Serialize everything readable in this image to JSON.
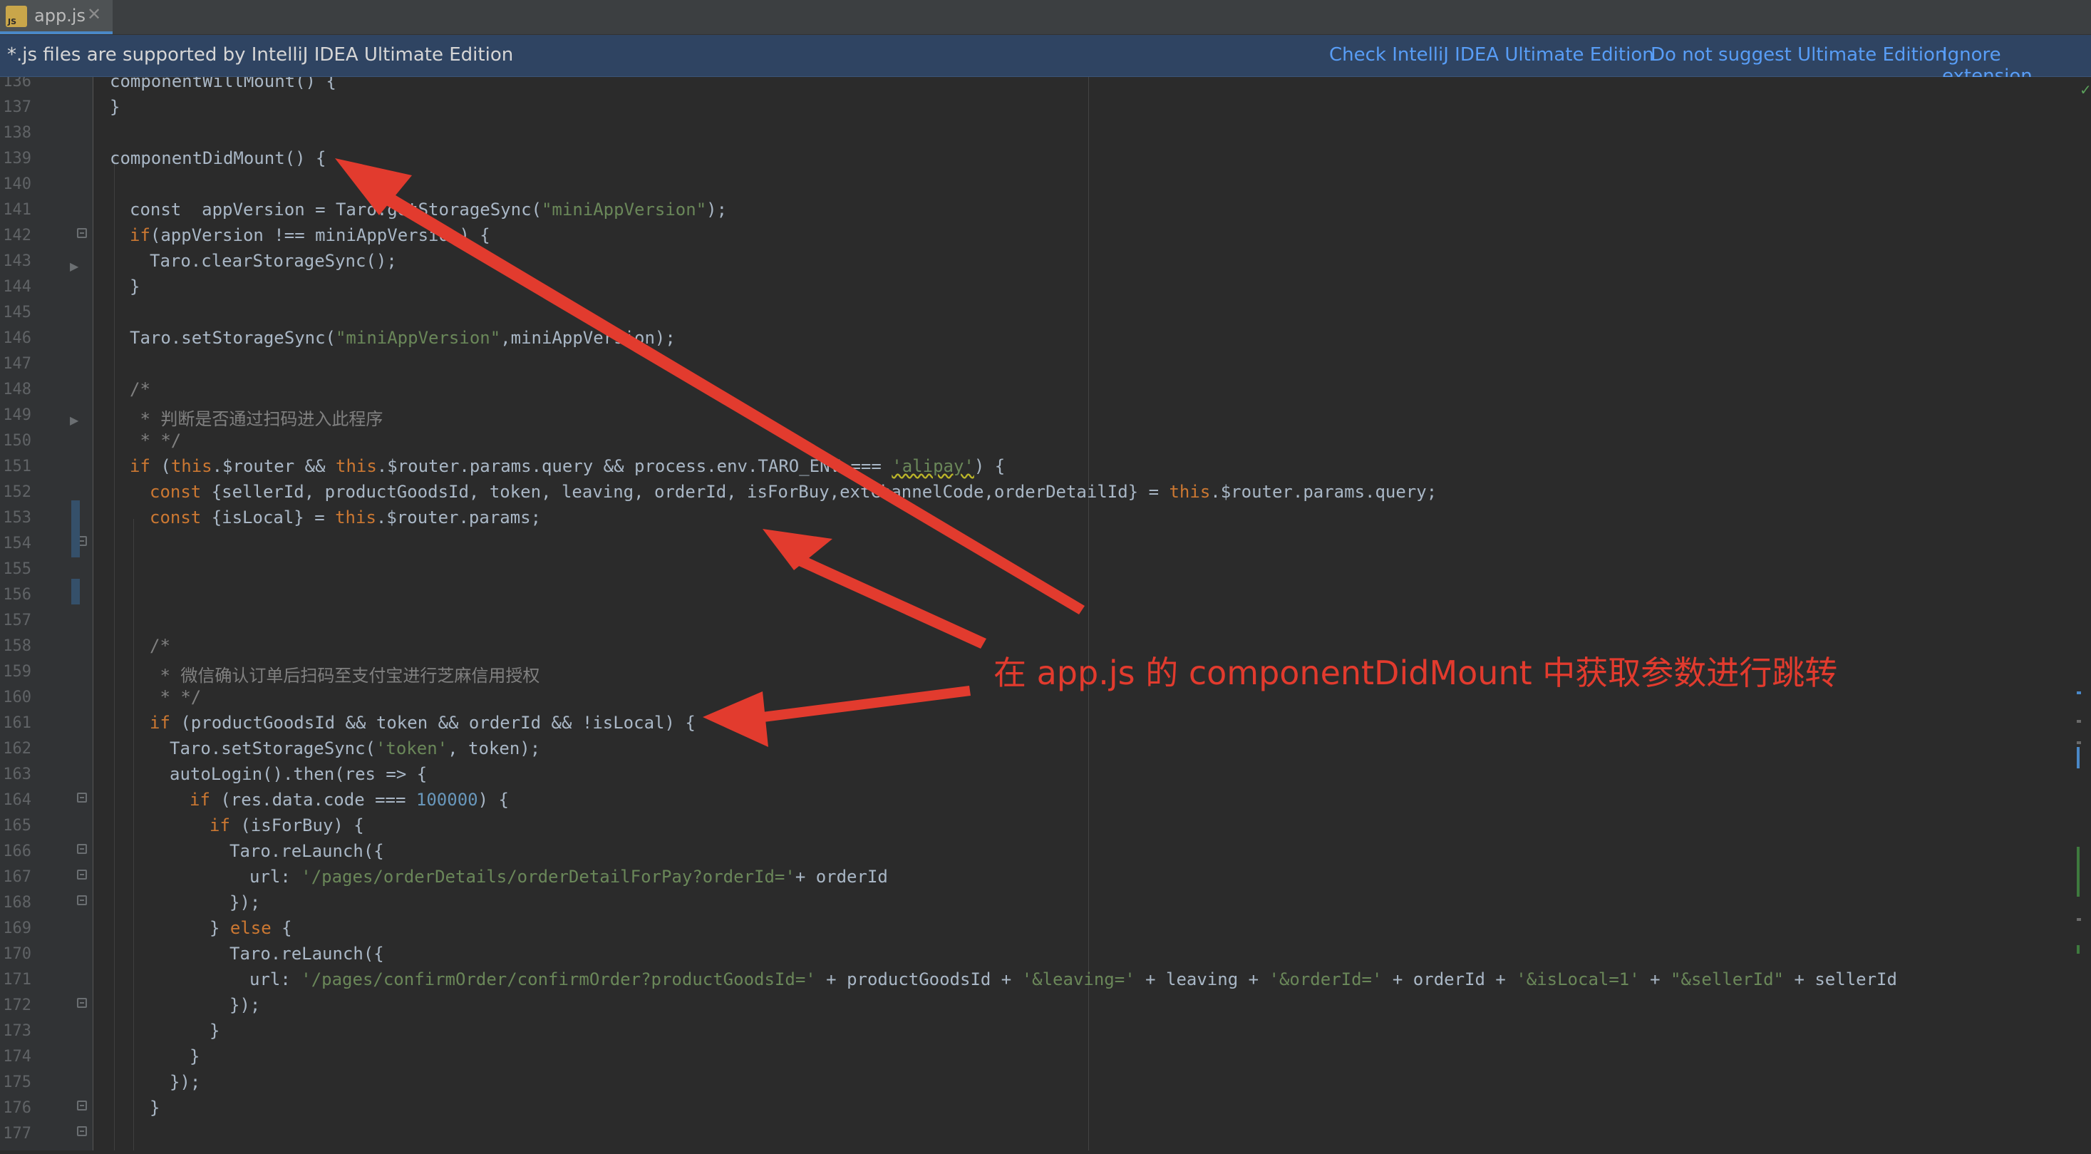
{
  "tab": {
    "icon_label": "JS",
    "label": "app.js",
    "close_glyph": "✕"
  },
  "banner": {
    "message": "*.js files are supported by IntelliJ IDEA Ultimate Edition",
    "links": {
      "check": "Check IntelliJ IDEA Ultimate Edition",
      "no_suggest": "Do not suggest Ultimate Edition",
      "ignore": "Ignore extension"
    }
  },
  "editor": {
    "line_numbers": [
      "136",
      "137",
      "138",
      "139",
      "140",
      "141",
      "142",
      "143",
      "144",
      "145",
      "146",
      "147",
      "148",
      "149",
      "150",
      "151",
      "152",
      "153",
      "154",
      "155",
      "156",
      "157",
      "158",
      "159",
      "160",
      "161",
      "162",
      "163",
      "164",
      "165",
      "166",
      "167",
      "168",
      "169",
      "170",
      "171",
      "172",
      "173",
      "174",
      "175",
      "176",
      "177"
    ],
    "code": {
      "l136": "componentWillMount() {",
      "l137": "}",
      "l139": "componentDidMount() {",
      "l141_a": "const  appVersion = Taro.getStorageSync(",
      "l141_s": "\"miniAppVersion\"",
      "l141_b": ");",
      "l142_k": "if",
      "l142_a": "(appVersion !== miniAppVersion) {",
      "l143": "Taro.clearStorageSync();",
      "l144": "}",
      "l146_a": "Taro.setStorageSync(",
      "l146_s": "\"miniAppVersion\"",
      "l146_b": ",miniAppVersion);",
      "l148": "/*",
      "l149": " * 判断是否通过扫码进入此程序",
      "l150": " * */",
      "l151_k1": "if",
      "l151_a": " (",
      "l151_k2": "this",
      "l151_b": ".$router && ",
      "l151_k3": "this",
      "l151_c": ".$router.params.query && process.env.TARO_ENV === ",
      "l151_s": "'alipay'",
      "l151_d": ") {",
      "l152_k": "const",
      "l152_a": " {sellerId, productGoodsId, token, leaving, orderId, isForBuy,extChannelCode,orderDetailId} = ",
      "l152_k2": "this",
      "l152_b": ".$router.params.query;",
      "l153_k": "const",
      "l153_a": " {isLocal} = ",
      "l153_k2": "this",
      "l153_b": ".$router.params;",
      "l158": "/*",
      "l159": " * 微信确认订单后扫码至支付宝进行芝麻信用授权",
      "l160": " * */",
      "l161_k": "if",
      "l161_a": " (productGoodsId && token && orderId && !isLocal) {",
      "l162_a": "Taro.setStorageSync(",
      "l162_s": "'token'",
      "l162_b": ", token);",
      "l163": "autoLogin().then(res => {",
      "l164_k": "if",
      "l164_a": " (res.data.code === ",
      "l164_n": "100000",
      "l164_b": ") {",
      "l165_k": "if",
      "l165_a": " (isForBuy) {",
      "l166": "Taro.reLaunch({",
      "l167_a": "url: ",
      "l167_s": "'/pages/orderDetails/orderDetailForPay?orderId='",
      "l167_b": "+ orderId",
      "l168": "});",
      "l169_a": "} ",
      "l169_k": "else",
      "l169_b": " {",
      "l170": "Taro.reLaunch({",
      "l171_a": "url: ",
      "l171_s1": "'/pages/confirmOrder/confirmOrder?productGoodsId='",
      "l171_b": " + productGoodsId + ",
      "l171_s2": "'&leaving='",
      "l171_c": " + leaving + ",
      "l171_s3": "'&orderId='",
      "l171_d": " + orderId + ",
      "l171_s4": "'&isLocal=1'",
      "l171_e": " + ",
      "l171_s5": "\"&sellerId\"",
      "l171_f": " + sellerId",
      "l172": "});",
      "l173": "}",
      "l174": "}",
      "l175": "});",
      "l176": "}"
    }
  },
  "annotation": {
    "text": "在 app.js 的 componentDidMount 中获取参数进行跳转",
    "color": "#e23b2e"
  },
  "colors": {
    "keyword": "#cc7832",
    "string": "#6a8759",
    "number": "#6897bb",
    "comment": "#808080",
    "default": "#a9b7c6",
    "banner_bg": "#2f4462",
    "link": "#589df6"
  }
}
